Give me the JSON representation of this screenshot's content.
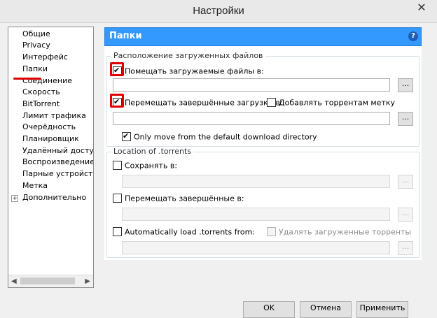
{
  "window": {
    "title": "Настройки",
    "close_glyph": "✕"
  },
  "sidebar": {
    "items": [
      {
        "label": "Общие"
      },
      {
        "label": "Privacy"
      },
      {
        "label": "Интерфейс"
      },
      {
        "label": "Папки"
      },
      {
        "label": "Соединение"
      },
      {
        "label": "Скорость"
      },
      {
        "label": "BitTorrent"
      },
      {
        "label": "Лимит трафика"
      },
      {
        "label": "Очерёдность"
      },
      {
        "label": "Планировщик"
      },
      {
        "label": "Удалённый доступ"
      },
      {
        "label": "Воспроизведение"
      },
      {
        "label": "Парные устройства"
      },
      {
        "label": "Метка"
      },
      {
        "label": "Дополнительно"
      }
    ],
    "expander_glyph": "+",
    "scroll_left": "◀",
    "scroll_right": "▶"
  },
  "panel": {
    "title": "Папки",
    "help_glyph": "?"
  },
  "downloads": {
    "legend": "Расположение загруженных файлов",
    "put_new_label": "Помещать загружаемые файлы в:",
    "put_new_value": "",
    "move_completed_label": "Перемещать завершённые загрузки в:",
    "move_completed_value": "",
    "append_label_label": "Добавлять торрентам метку",
    "only_move_label": "Only move from the default download directory",
    "browse_label": "..."
  },
  "torrents": {
    "legend": "Location of .torrents",
    "store_label": "Сохранять в:",
    "store_value": "",
    "move_completed_label": "Перемещать завершённые в:",
    "move_completed_value": "",
    "autoload_label": "Automatically load .torrents from:",
    "autoload_value": "",
    "delete_loaded_label": "Удалять загруженные торренты",
    "browse_label": "..."
  },
  "footer": {
    "ok_label": "OK",
    "cancel_label": "Отмена",
    "apply_label": "Применить"
  },
  "colors": {
    "header": "#3399ff",
    "highlight": "#e00000"
  }
}
